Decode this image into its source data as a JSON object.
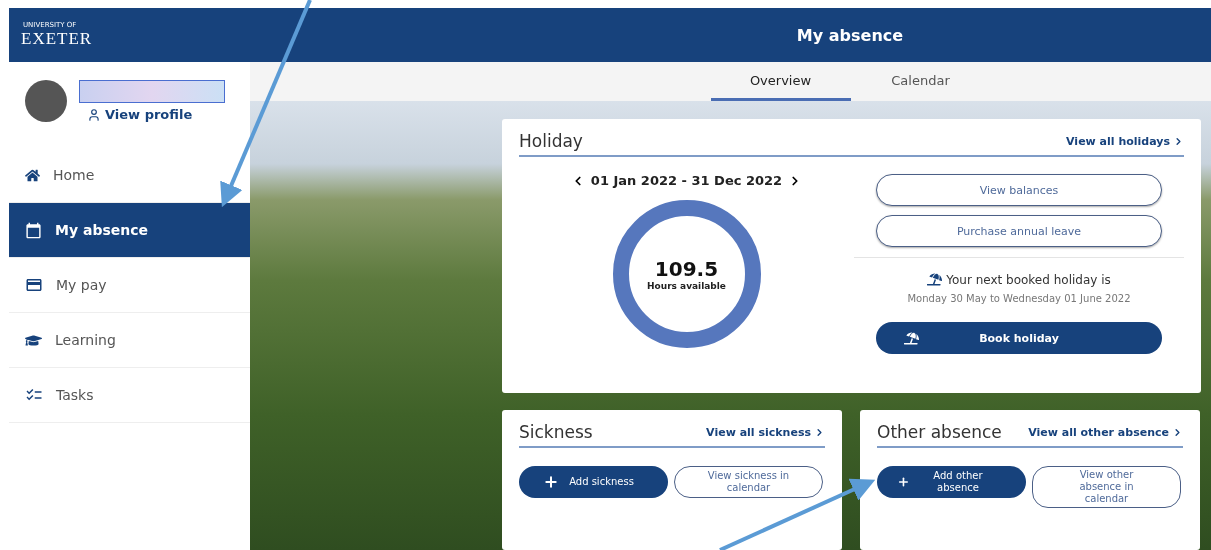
{
  "header": {
    "logo_small": "UNIVERSITY OF",
    "logo": "EXETER",
    "title": "My absence"
  },
  "profile": {
    "link": "View profile"
  },
  "nav": [
    {
      "label": "Home",
      "selected": false
    },
    {
      "label": "My absence",
      "selected": true
    },
    {
      "label": "My pay",
      "selected": false
    },
    {
      "label": "Learning",
      "selected": false
    },
    {
      "label": "Tasks",
      "selected": false
    }
  ],
  "tabs": [
    {
      "label": "Overview",
      "selected": true
    },
    {
      "label": "Calendar",
      "selected": false
    }
  ],
  "holiday": {
    "title": "Holiday",
    "link": "View all holidays",
    "period": "01 Jan 2022 - 31 Dec 2022",
    "hours": "109.5",
    "hours_label": "Hours available",
    "buttons": [
      "View balances",
      "Purchase annual leave"
    ],
    "next_label": "Your next booked holiday is",
    "next_dates": "Monday 30 May to Wednesday 01 June 2022",
    "book": "Book holiday"
  },
  "sickness": {
    "title": "Sickness",
    "link": "View all sickness",
    "primary": "Add sickness",
    "secondary": "View sickness in calendar"
  },
  "other": {
    "title": "Other absence",
    "link": "View all other absence",
    "primary": "Add other absence",
    "secondary": "View other absence in calendar"
  }
}
